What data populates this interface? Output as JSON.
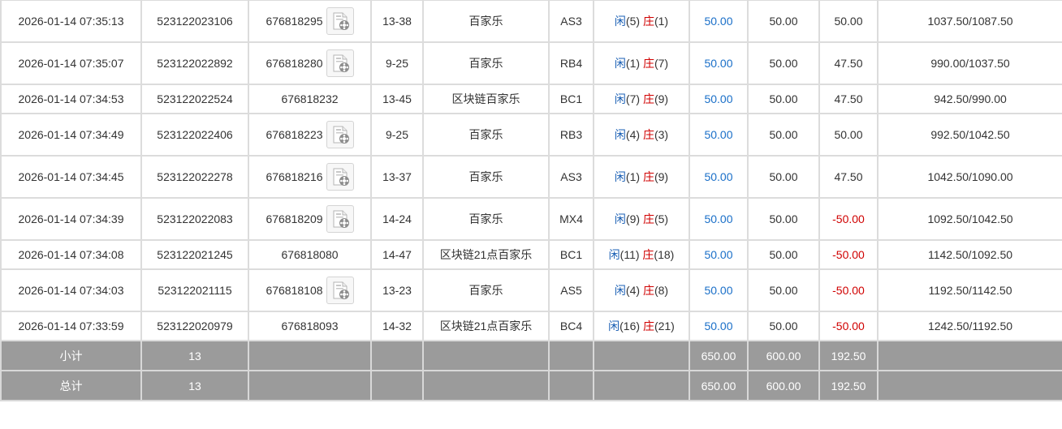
{
  "rows": [
    {
      "time": "2026-01-14 07:35:13",
      "bet_no": "523122023106",
      "round": "676818295",
      "has_video": true,
      "table": "13-38",
      "game": "百家乐",
      "shoe": "AS3",
      "player_label": "闲",
      "player_points": "(5)",
      "banker_label": "庄",
      "banker_points": "(1)",
      "bet": "50.00",
      "valid": "50.00",
      "win": "50.00",
      "win_negative": false,
      "balance": "1037.50/1087.50"
    },
    {
      "time": "2026-01-14 07:35:07",
      "bet_no": "523122022892",
      "round": "676818280",
      "has_video": true,
      "table": "9-25",
      "game": "百家乐",
      "shoe": "RB4",
      "player_label": "闲",
      "player_points": "(1)",
      "banker_label": "庄",
      "banker_points": "(7)",
      "bet": "50.00",
      "valid": "50.00",
      "win": "47.50",
      "win_negative": false,
      "balance": "990.00/1037.50"
    },
    {
      "time": "2026-01-14 07:34:53",
      "bet_no": "523122022524",
      "round": "676818232",
      "has_video": false,
      "table": "13-45",
      "game": "区块链百家乐",
      "shoe": "BC1",
      "player_label": "闲",
      "player_points": "(7)",
      "banker_label": "庄",
      "banker_points": "(9)",
      "bet": "50.00",
      "valid": "50.00",
      "win": "47.50",
      "win_negative": false,
      "balance": "942.50/990.00"
    },
    {
      "time": "2026-01-14 07:34:49",
      "bet_no": "523122022406",
      "round": "676818223",
      "has_video": true,
      "table": "9-25",
      "game": "百家乐",
      "shoe": "RB3",
      "player_label": "闲",
      "player_points": "(4)",
      "banker_label": "庄",
      "banker_points": "(3)",
      "bet": "50.00",
      "valid": "50.00",
      "win": "50.00",
      "win_negative": false,
      "balance": "992.50/1042.50"
    },
    {
      "time": "2026-01-14 07:34:45",
      "bet_no": "523122022278",
      "round": "676818216",
      "has_video": true,
      "table": "13-37",
      "game": "百家乐",
      "shoe": "AS3",
      "player_label": "闲",
      "player_points": "(1)",
      "banker_label": "庄",
      "banker_points": "(9)",
      "bet": "50.00",
      "valid": "50.00",
      "win": "47.50",
      "win_negative": false,
      "balance": "1042.50/1090.00"
    },
    {
      "time": "2026-01-14 07:34:39",
      "bet_no": "523122022083",
      "round": "676818209",
      "has_video": true,
      "table": "14-24",
      "game": "百家乐",
      "shoe": "MX4",
      "player_label": "闲",
      "player_points": "(9)",
      "banker_label": "庄",
      "banker_points": "(5)",
      "bet": "50.00",
      "valid": "50.00",
      "win": "-50.00",
      "win_negative": true,
      "balance": "1092.50/1042.50"
    },
    {
      "time": "2026-01-14 07:34:08",
      "bet_no": "523122021245",
      "round": "676818080",
      "has_video": false,
      "table": "14-47",
      "game": "区块链21点百家乐",
      "shoe": "BC1",
      "player_label": "闲",
      "player_points": "(11)",
      "banker_label": "庄",
      "banker_points": "(18)",
      "bet": "50.00",
      "valid": "50.00",
      "win": "-50.00",
      "win_negative": true,
      "balance": "1142.50/1092.50"
    },
    {
      "time": "2026-01-14 07:34:03",
      "bet_no": "523122021115",
      "round": "676818108",
      "has_video": true,
      "table": "13-23",
      "game": "百家乐",
      "shoe": "AS5",
      "player_label": "闲",
      "player_points": "(4)",
      "banker_label": "庄",
      "banker_points": "(8)",
      "bet": "50.00",
      "valid": "50.00",
      "win": "-50.00",
      "win_negative": true,
      "balance": "1192.50/1142.50"
    },
    {
      "time": "2026-01-14 07:33:59",
      "bet_no": "523122020979",
      "round": "676818093",
      "has_video": false,
      "table": "14-32",
      "game": "区块链21点百家乐",
      "shoe": "BC4",
      "player_label": "闲",
      "player_points": "(16)",
      "banker_label": "庄",
      "banker_points": "(21)",
      "bet": "50.00",
      "valid": "50.00",
      "win": "-50.00",
      "win_negative": true,
      "balance": "1242.50/1192.50"
    }
  ],
  "subtotal": {
    "label": "小计",
    "count": "13",
    "bet": "650.00",
    "valid": "600.00",
    "win": "192.50"
  },
  "total": {
    "label": "总计",
    "count": "13",
    "bet": "650.00",
    "valid": "600.00",
    "win": "192.50"
  },
  "icons": {
    "video": "video-replay-icon"
  },
  "colors": {
    "player": "#1a5fb4",
    "banker": "#d00000",
    "bet": "#1a6fc8",
    "negative": "#d00000",
    "summary_bg": "#9b9b9b",
    "border": "#dcdcdc"
  }
}
